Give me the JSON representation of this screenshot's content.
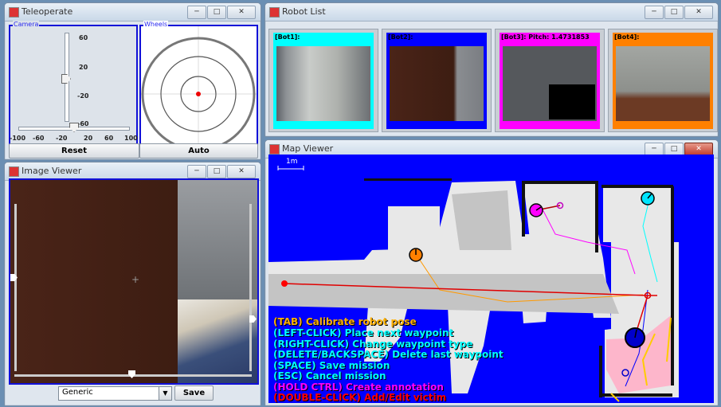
{
  "colors": {
    "map_blue": "#0000ff",
    "bot1": "#00ffff",
    "bot2": "#0000ff",
    "bot3": "#ff00ff",
    "bot4": "#ff8000"
  },
  "teleop": {
    "title": "Teleoperate",
    "camera_label": "Camera",
    "wheels_label": "Wheels",
    "vertical_ticks": [
      "60",
      "20",
      "-20",
      "-60"
    ],
    "horizontal_ticks": [
      "-100",
      "-60",
      "-20",
      "20",
      "60",
      "100"
    ],
    "reset_label": "Reset",
    "auto_label": "Auto"
  },
  "robot_list": {
    "title": "Robot List",
    "robots": [
      {
        "label": "[Bot1]:",
        "color": "#00ffff"
      },
      {
        "label": "[Bot2]:",
        "color": "#0000ff"
      },
      {
        "label": "[Bot3]: Pitch: 1.4731853",
        "color": "#ff00ff"
      },
      {
        "label": "[Bot4]:",
        "color": "#ff8000"
      }
    ]
  },
  "image_viewer": {
    "title": "Image Viewer",
    "select_value": "Generic",
    "save_label": "Save"
  },
  "map_viewer": {
    "title": "Map Viewer",
    "scale_label": "1m",
    "help": [
      {
        "text": "(TAB) Calibrate robot pose",
        "color": "#ffb000"
      },
      {
        "text": "(LEFT-CLICK) Place next waypoint",
        "color": "#00ffff"
      },
      {
        "text": "(RIGHT-CLICK) Change waypoint type",
        "color": "#00ffff"
      },
      {
        "text": "(DELETE/BACKSPACE) Delete last waypoint",
        "color": "#00ffff"
      },
      {
        "text": "(SPACE) Save mission",
        "color": "#00ffff"
      },
      {
        "text": "(ESC) Cancel mission",
        "color": "#00ffff"
      },
      {
        "text": "(HOLD CTRL) Create annotation",
        "color": "#ff00ff"
      },
      {
        "text": "(DOUBLE-CLICK) Add/Edit victim",
        "color": "#ff0000"
      }
    ]
  }
}
